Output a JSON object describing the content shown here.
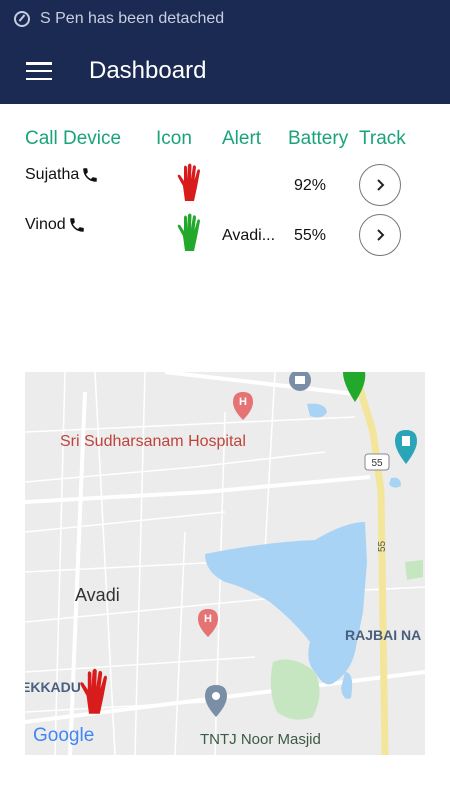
{
  "status_bar": {
    "message": "S Pen has been detached",
    "icon": "s-pen-icon"
  },
  "app_bar": {
    "title": "Dashboard",
    "menu_icon": "hamburger-menu-icon"
  },
  "table": {
    "headers": [
      "Call Device",
      "Icon",
      "Alert",
      "Battery",
      "Track"
    ],
    "rows": [
      {
        "name": "Sujatha",
        "icon_color": "#d81b1b",
        "alert": "",
        "battery": "92%"
      },
      {
        "name": "Vinod",
        "icon_color": "#22a82b",
        "alert": "Avadi...",
        "battery": "55%"
      }
    ]
  },
  "map": {
    "labels": {
      "hospital": "Sri Sudharsanam Hospital",
      "avadi": "Avadi",
      "rajbai": "RAJBAI NA",
      "ekkadu": "EKKADU",
      "masjid": "TNTJ Noor Masjid",
      "highway_badge": "55",
      "highway_label": "55",
      "google": "Google"
    },
    "colors": {
      "water": "#a8d3f5",
      "road": "#ffffff",
      "highway": "#f3e59a",
      "park": "#c6e6c1",
      "land": "#ececec"
    }
  }
}
